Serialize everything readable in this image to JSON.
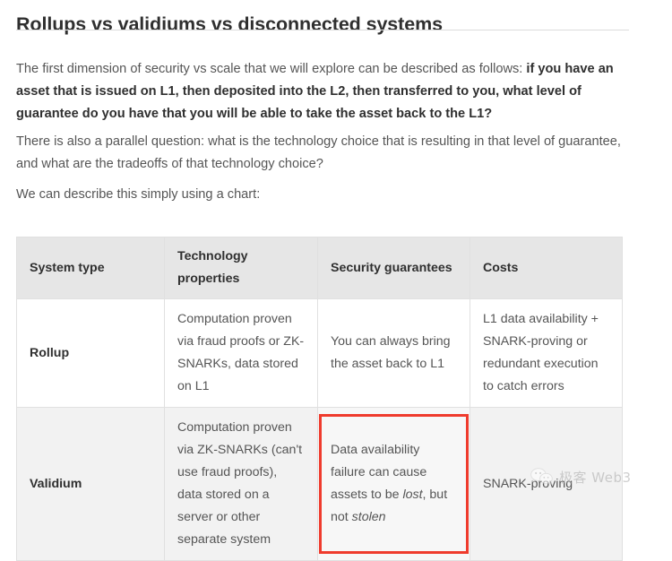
{
  "article": {
    "title": "Rollups vs validiums vs disconnected systems",
    "paragraphs": [
      {
        "id": "para-1",
        "runs": [
          {
            "text": "The first dimension of security vs scale that we will explore can be described as follows: ",
            "bold": false
          },
          {
            "text": "if you have an asset that is issued on L1, then deposited into the L2, then transferred to you, what level of guarantee do you have that you will be able to take the asset back to the L1?",
            "bold": true
          }
        ]
      },
      {
        "id": "para-2",
        "runs": [
          {
            "text": "There is also a parallel question: what is the technology choice that is resulting in that level of guarantee, and what are the tradeoffs of that technology choice?",
            "bold": false
          }
        ]
      },
      {
        "id": "para-3",
        "runs": [
          {
            "text": "We can describe this simply using a chart:",
            "bold": false
          }
        ]
      }
    ]
  },
  "table": {
    "headers": [
      "System type",
      "Technology properties",
      "Security guarantees",
      "Costs"
    ],
    "rows": [
      {
        "system_type": "Rollup",
        "technology_properties": "Computation proven via fraud proofs or ZK-SNARKs, data stored on L1",
        "security_guarantees": "You can always bring the asset back to L1",
        "costs": "L1 data availability + SNARK-proving or redundant execution to catch errors",
        "highlight_cell": null
      },
      {
        "system_type": "Validium",
        "technology_properties": "Computation proven via ZK-SNARKs (can't use fraud proofs), data stored on a server or other separate system",
        "security_guarantees_runs": [
          {
            "text": "Data availability failure can cause assets to be ",
            "italic": false
          },
          {
            "text": "lost",
            "italic": true
          },
          {
            "text": ", but not ",
            "italic": false
          },
          {
            "text": "stolen",
            "italic": true
          }
        ],
        "costs": "SNARK-proving",
        "highlight_cell": "security_guarantees"
      }
    ]
  },
  "highlight": {
    "color": "#ef3b2d",
    "target": "validium-security-guarantees-cell"
  },
  "watermark": {
    "icon": "wechat-icon",
    "text": "极客 Web3"
  },
  "colors": {
    "title": "#2f2f2f",
    "body_text": "#555555",
    "table_header_bg": "#e6e6e6",
    "table_border": "#e0e0e0",
    "row_stripe_bg": "#f2f2f2",
    "highlight_red": "#ef3b2d",
    "rule": "#dcdcdc"
  }
}
